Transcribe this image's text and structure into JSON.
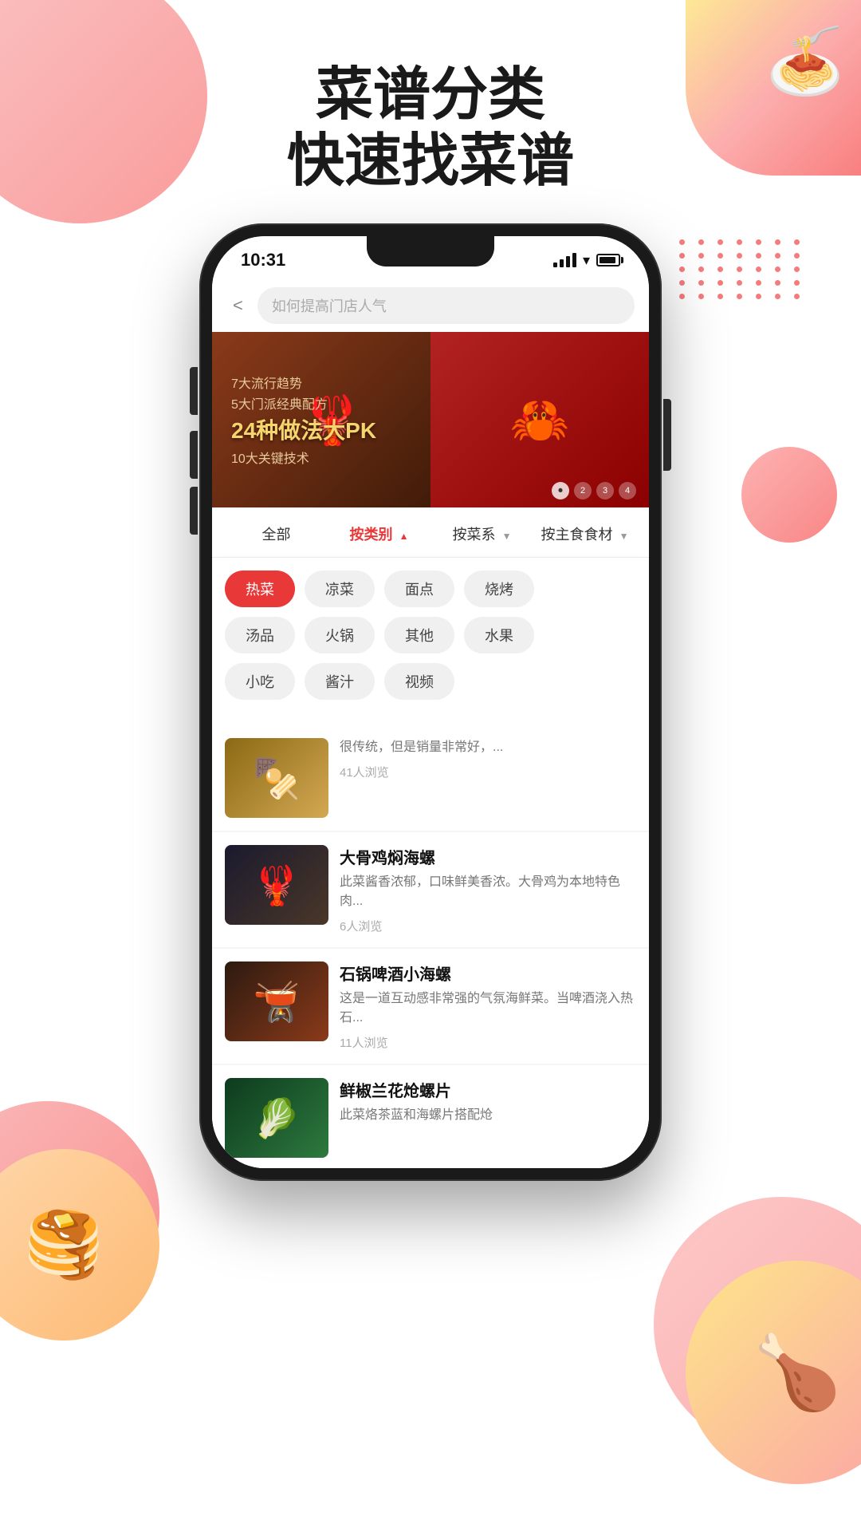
{
  "app": {
    "title": "菜谱分类",
    "subtitle": "快速找菜谱"
  },
  "status_bar": {
    "time": "10:31",
    "signal_label": "signal",
    "wifi_label": "wifi",
    "battery_label": "battery"
  },
  "search": {
    "placeholder": "如何提高门店人气",
    "back_label": "<"
  },
  "banner": {
    "line1": "7大流行趋势",
    "line2": "5大门派经典配方",
    "main": "24种做法大PK",
    "sub": "10大关键技术",
    "indicators": [
      "2",
      "3",
      "4"
    ]
  },
  "filter_tabs": [
    {
      "label": "全部",
      "active": false,
      "has_arrow": false
    },
    {
      "label": "按类别",
      "active": true,
      "has_arrow_up": true
    },
    {
      "label": "按菜系",
      "active": false,
      "has_arrow_down": true
    },
    {
      "label": "按主食食材",
      "active": false,
      "has_arrow_down": true
    }
  ],
  "categories": [
    {
      "label": "热菜",
      "active": true
    },
    {
      "label": "凉菜",
      "active": false
    },
    {
      "label": "面点",
      "active": false
    },
    {
      "label": "烧烤",
      "active": false
    },
    {
      "label": "汤品",
      "active": false
    },
    {
      "label": "火锅",
      "active": false
    },
    {
      "label": "其他",
      "active": false
    },
    {
      "label": "水果",
      "active": false
    },
    {
      "label": "小吃",
      "active": false
    },
    {
      "label": "酱汁",
      "active": false
    },
    {
      "label": "视频",
      "active": false
    }
  ],
  "recipes": [
    {
      "title": "大骨鸡焖海螺",
      "desc": "此菜酱香浓郁，口味鲜美香浓。大骨鸡为本地特色肉...",
      "views": "6人浏览",
      "emoji": "🦞"
    },
    {
      "title": "石锅啤酒小海螺",
      "desc": "这是一道互动感非常强的气氛海鲜菜。当啤酒浇入热石...",
      "views": "11人浏览",
      "emoji": "🫕"
    },
    {
      "title": "鲜椒兰花炝螺片",
      "desc": "此菜烙茶蓝和海螺片搭配炝",
      "views": "",
      "emoji": "🥬"
    }
  ],
  "partial_item": {
    "desc": "很传统，但是销量非常好，...",
    "views": "41人浏览"
  },
  "dots": [
    1,
    2,
    3,
    4,
    5,
    6,
    7,
    8,
    9,
    10,
    11,
    12,
    13,
    14,
    15,
    16,
    17,
    18,
    19,
    20,
    21,
    22,
    23,
    24,
    25,
    26,
    27,
    28,
    29,
    30,
    31,
    32,
    33,
    34,
    35
  ]
}
